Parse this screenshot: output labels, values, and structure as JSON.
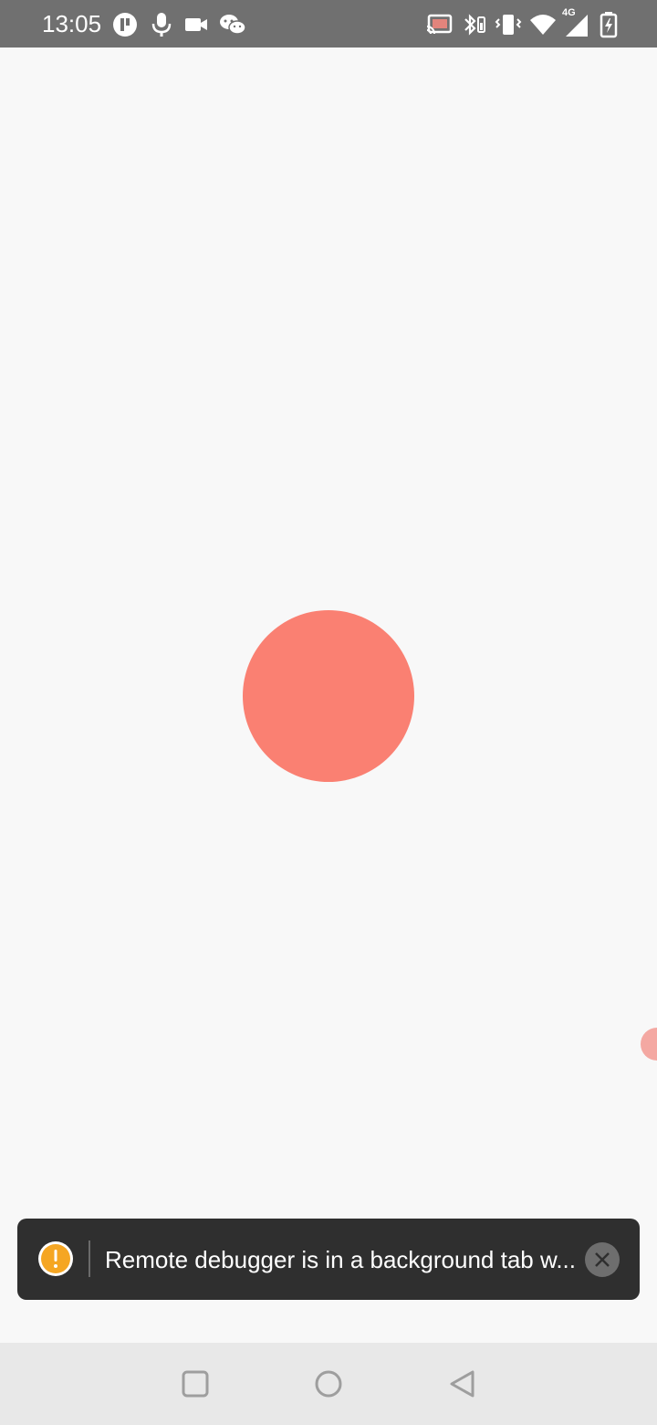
{
  "status_bar": {
    "time": "13:05",
    "left_icons": [
      "t-app-icon",
      "microphone-icon",
      "video-camera-icon",
      "wechat-icon"
    ],
    "right_icons": [
      "cast-icon",
      "bluetooth-battery-icon",
      "vibrate-icon",
      "wifi-icon",
      "cellular-4g-icon",
      "battery-charging-icon"
    ],
    "network_label": "4G",
    "background_color": "#707070"
  },
  "canvas": {
    "background_color": "#f8f8f8",
    "circle_color": "#fa8072",
    "edge_dot_color": "#f4a8a2"
  },
  "toast": {
    "icon": "warning-icon",
    "warning_color": "#f5a623",
    "message": "Remote debugger is in a background tab w...",
    "close_icon": "close-icon",
    "background_color": "#2f2f2f"
  },
  "nav_bar": {
    "buttons": [
      "recents-square-icon",
      "home-circle-icon",
      "back-triangle-icon"
    ],
    "background_color": "#e8e8e8"
  }
}
